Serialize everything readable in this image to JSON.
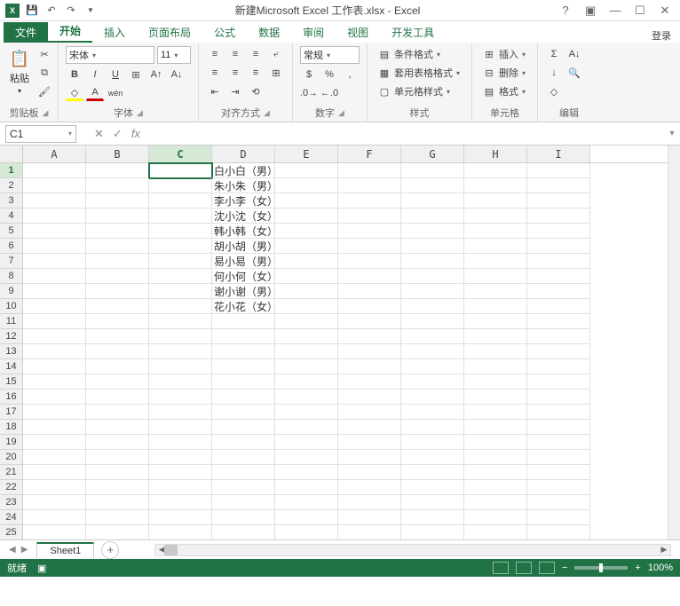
{
  "title": "新建Microsoft Excel 工作表.xlsx - Excel",
  "login": "登录",
  "tabs": {
    "file": "文件",
    "home": "开始",
    "insert": "插入",
    "layout": "页面布局",
    "formulas": "公式",
    "data": "数据",
    "review": "审阅",
    "view": "视图",
    "dev": "开发工具"
  },
  "ribbon": {
    "clipboard": {
      "label": "剪贴板",
      "paste": "粘贴"
    },
    "font": {
      "label": "字体",
      "name": "宋体",
      "size": "11"
    },
    "align": {
      "label": "对齐方式"
    },
    "number": {
      "label": "数字",
      "format": "常规"
    },
    "styles": {
      "label": "样式",
      "cond": "条件格式",
      "table": "套用表格格式",
      "cell": "单元格样式"
    },
    "cells": {
      "label": "单元格",
      "insert": "插入",
      "delete": "删除",
      "format": "格式"
    },
    "editing": {
      "label": "编辑"
    }
  },
  "namebox": "C1",
  "formula": "",
  "columns": [
    "A",
    "B",
    "C",
    "D",
    "E",
    "F",
    "G",
    "H",
    "I"
  ],
  "rowcount": 25,
  "selected": {
    "row": 1,
    "col": "C"
  },
  "cells": {
    "D1": "白小白（男）",
    "D2": "朱小朱（男）",
    "D3": "李小李（女）",
    "D4": "沈小沈（女）",
    "D5": "韩小韩（女）",
    "D6": "胡小胡（男）",
    "D7": "易小易（男）",
    "D8": "何小何（女）",
    "D9": "谢小谢（男）",
    "D10": "花小花（女）"
  },
  "sheet": "Sheet1",
  "status": {
    "ready": "就绪",
    "zoom": "100%"
  }
}
